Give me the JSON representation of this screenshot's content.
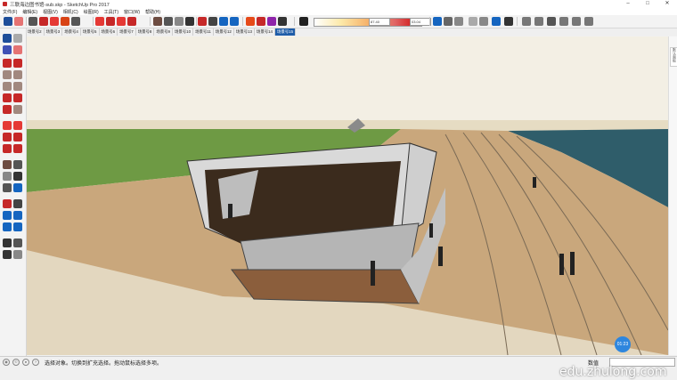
{
  "window": {
    "title": "三联海边图书馆-sub.skp - SketchUp Pro 2017"
  },
  "menu": [
    "文件(F)",
    "编辑(E)",
    "视图(V)",
    "相机(C)",
    "绘图(R)",
    "工具(T)",
    "窗口(W)",
    "帮助(H)"
  ],
  "style_fields": {
    "left_value": "87.40",
    "right_value": "03.04"
  },
  "scene_tabs": [
    "场景号2",
    "场景号3",
    "场景号4",
    "场景号5",
    "场景号6",
    "场景号7",
    "场景号8",
    "场景号9",
    "场景号10",
    "场景号11",
    "场景号12",
    "场景号13",
    "场景号14",
    "场景号15"
  ],
  "active_scene_tab": "场景号15",
  "right_panel": {
    "tab_label": "默认面板"
  },
  "status": {
    "hint": "选择对象。切换到扩充选择。拖动鼠标选择多项。",
    "measurement_label": "数值",
    "measurement_value": ""
  },
  "overlay": {
    "badge": "01:23",
    "watermark": "edu.zhulong.com"
  },
  "colors": {
    "sky": "#f3efe4",
    "grass": "#6e9a44",
    "sand": "#c9a77c",
    "sea": "#2f5d6a",
    "active_tab": "#1e5ca8"
  }
}
